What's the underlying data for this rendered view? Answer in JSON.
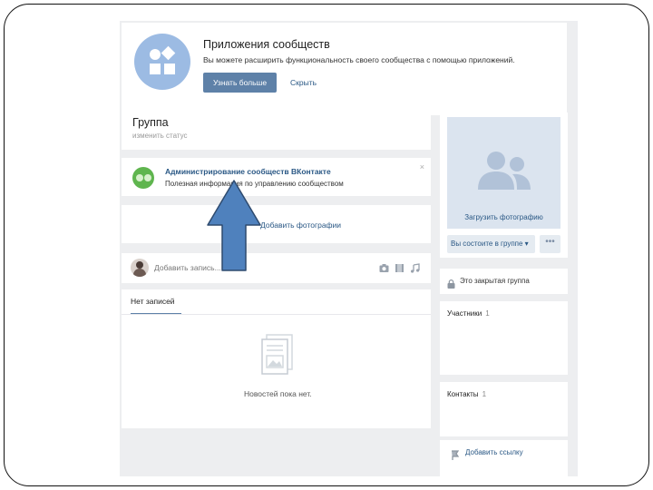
{
  "apps_banner": {
    "title": "Приложения сообществ",
    "description": "Вы можете расширить функциональность своего сообщества с помощью приложений.",
    "more_button": "Узнать больше",
    "hide_button": "Скрыть"
  },
  "group": {
    "name": "Группа",
    "status_placeholder": "изменить статус"
  },
  "admin_info": {
    "title": "Администрирование сообществ ВКонтакте",
    "subtitle": "Полезная информация по управлению сообществом",
    "close": "×"
  },
  "photos": {
    "label": "Добавить фотографии"
  },
  "new_post": {
    "placeholder": "Добавить запись..."
  },
  "wall": {
    "tab_label": "Нет записей",
    "empty_text": "Новостей пока нет."
  },
  "sidebar": {
    "upload_photo": "Загрузить фотографию",
    "member_button": "Вы состоите в группе ▾",
    "more_button": "•••",
    "closed_group": "Это закрытая группа",
    "members_label": "Участники",
    "members_count": "1",
    "contacts_label": "Контакты",
    "contacts_count": "1",
    "add_link": "Добавить ссылку"
  },
  "colors": {
    "accent": "#5e81a8",
    "link": "#2a5885",
    "page_bg": "#edeef0",
    "arrow_fill": "#4f81bd",
    "arrow_stroke": "#2e4a6e"
  },
  "icons": [
    "apps-icon",
    "group-icon",
    "camera-icon",
    "video-icon",
    "music-icon",
    "lock-icon",
    "link-icon",
    "document-icon"
  ]
}
